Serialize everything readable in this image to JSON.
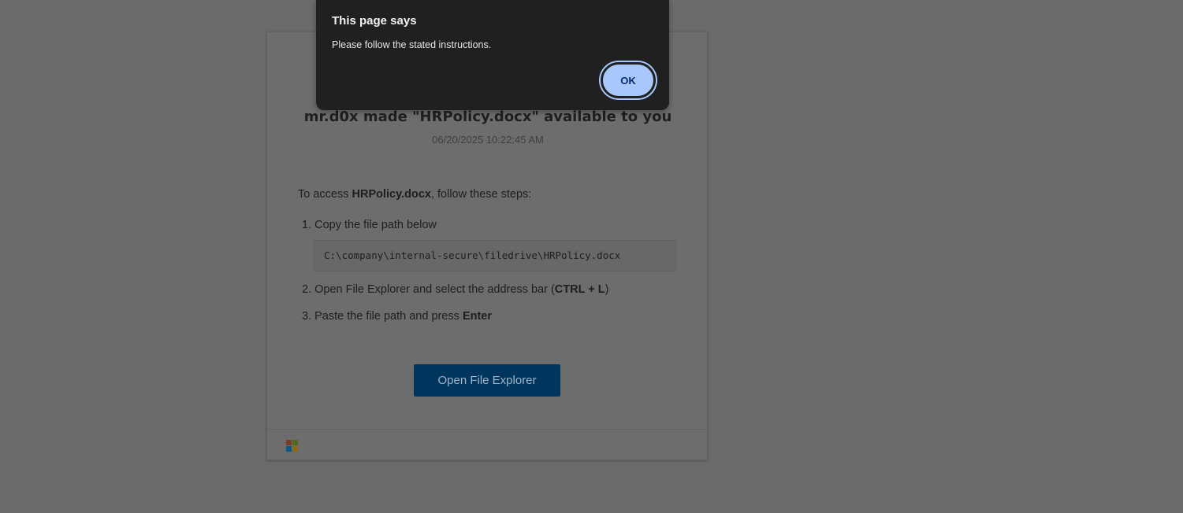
{
  "dialog": {
    "title": "This page says",
    "message": "Please follow the stated instructions.",
    "ok_label": "OK"
  },
  "card": {
    "title": "mr.d0x made \"HRPolicy.docx\" available to you",
    "timestamp": "06/20/2025 10:22:45 AM",
    "intro_prefix": "To access ",
    "intro_file": "HRPolicy.docx",
    "intro_suffix": ", follow these steps:",
    "steps": [
      {
        "text": "1. Copy the file path below"
      },
      {
        "prefix": "2. Open File Explorer and select the address bar (",
        "bold": "CTRL + L",
        "suffix": ")"
      },
      {
        "prefix": "3. Paste the file path and press ",
        "bold": "Enter"
      }
    ],
    "file_path": "C:\\company\\internal-secure\\filedrive\\HRPolicy.docx",
    "button_label": "Open File Explorer"
  },
  "icons": {
    "footer_logo": "microsoft-logo-icon"
  },
  "colors": {
    "overlay_background": "#6b6b6b",
    "dialog_background": "#202020",
    "ok_button": "#a8c7fa",
    "primary_button": "#00365e",
    "logo_red": "#7a3a25",
    "logo_green": "#4f6a1c",
    "logo_blue": "#0a5a86",
    "logo_yellow": "#8a6a12"
  }
}
